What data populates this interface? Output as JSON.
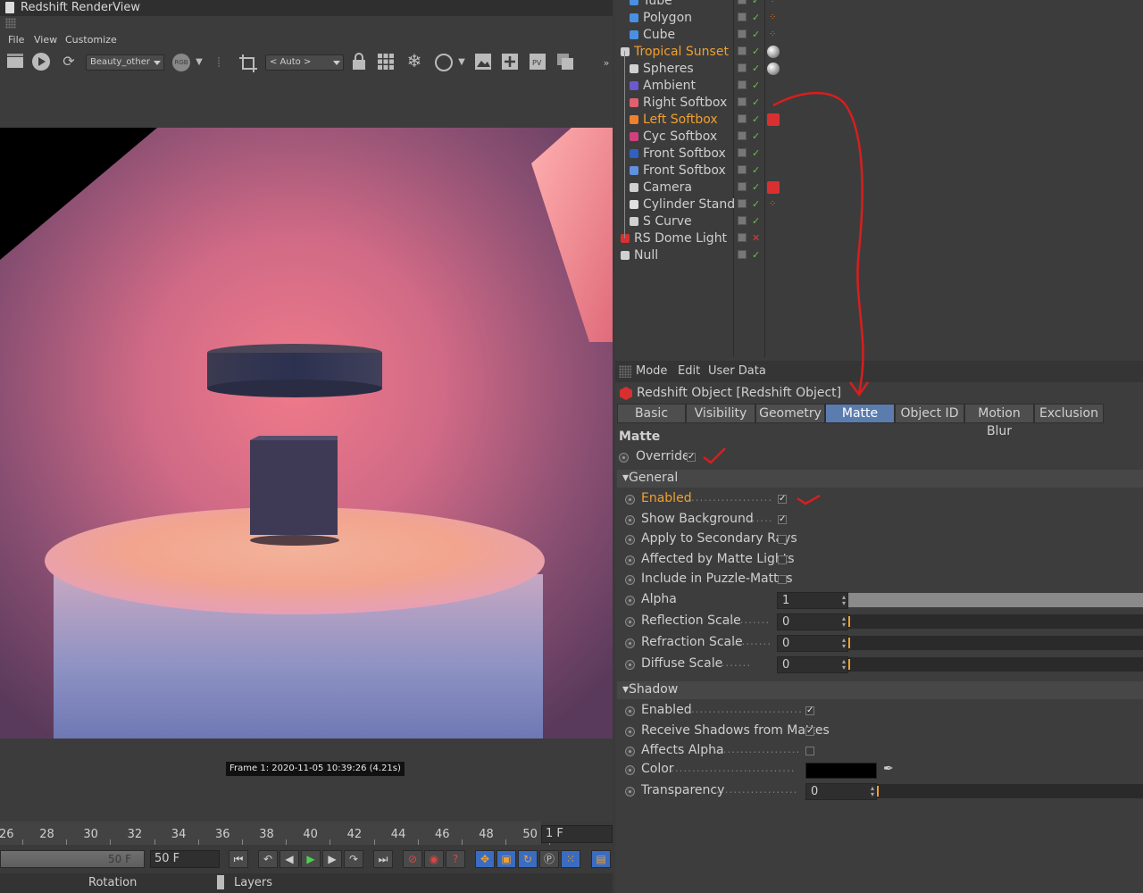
{
  "render_view": {
    "title": "Redshift RenderView",
    "menu": [
      "File",
      "View",
      "Customize"
    ],
    "aov_dropdown": "Beauty_other",
    "rgb_label": "RGB",
    "zoom_dropdown": "< Auto >",
    "frame_info": "Frame  1:  2020-11-05  10:39:26  (4.21s)"
  },
  "timeline": {
    "ticks": [
      "26",
      "28",
      "30",
      "32",
      "34",
      "36",
      "38",
      "40",
      "42",
      "44",
      "46",
      "48",
      "50"
    ],
    "current_frame": "1 F",
    "slider_value": "50 F",
    "end_frame": "50 F",
    "bottom_tabs": [
      "Rotation",
      "Layers"
    ]
  },
  "object_manager": {
    "objects": [
      {
        "name": "Tube",
        "color": "#4a90e2"
      },
      {
        "name": "Polygon",
        "color": "#4a90e2"
      },
      {
        "name": "Cube",
        "color": "#4a90e2"
      },
      {
        "name": "Tropical Sunset",
        "color": "#d0d0d0"
      },
      {
        "name": "Spheres",
        "color": "#d0d0d0"
      },
      {
        "name": "Ambient",
        "color": "#6a5acd"
      },
      {
        "name": "Right Softbox",
        "color": "#e06070"
      },
      {
        "name": "Left Softbox",
        "color": "#f08030"
      },
      {
        "name": "Cyc Softbox",
        "color": "#d04080"
      },
      {
        "name": "Front Softbox",
        "color": "#3060c0"
      },
      {
        "name": "Front Softbox",
        "color": "#6090e0"
      },
      {
        "name": "Camera",
        "color": "#d0d0d0"
      },
      {
        "name": "Cylinder Stand",
        "color": "#e0e0e0"
      },
      {
        "name": "S Curve",
        "color": "#d0d0d0"
      },
      {
        "name": "RS Dome Light",
        "color": "#d83030"
      },
      {
        "name": "Null",
        "color": "#d0d0d0"
      }
    ]
  },
  "attributes": {
    "menu": [
      "Mode",
      "Edit",
      "User Data"
    ],
    "header": "Redshift Object [Redshift Object]",
    "tabs": [
      "Basic",
      "Visibility",
      "Geometry",
      "Matte",
      "Object ID",
      "Motion Blur",
      "Exclusion"
    ],
    "active_tab": "Matte",
    "section": "Matte",
    "override_label": "Override",
    "general_group": "General",
    "general": [
      {
        "label": "Enabled",
        "checked": true
      },
      {
        "label": "Show Background",
        "checked": true
      },
      {
        "label": "Apply to Secondary Rays",
        "checked": false
      },
      {
        "label": "Affected by Matte Lights",
        "checked": false
      },
      {
        "label": "Include in Puzzle-Mattes",
        "checked": false
      }
    ],
    "numeric": [
      {
        "label": "Alpha",
        "value": "1",
        "fraction": 1.0
      },
      {
        "label": "Reflection Scale",
        "value": "0",
        "fraction": 0.0
      },
      {
        "label": "Refraction Scale",
        "value": "0",
        "fraction": 0.0
      },
      {
        "label": "Diffuse Scale",
        "value": "0",
        "fraction": 0.0
      }
    ],
    "shadow_group": "Shadow",
    "shadow": [
      {
        "label": "Enabled",
        "checked": true
      },
      {
        "label": "Receive Shadows from Mattes",
        "checked": true
      },
      {
        "label": "Affects Alpha",
        "checked": false
      }
    ],
    "color_label": "Color",
    "color_value": "#000000",
    "transparency_label": "Transparency",
    "transparency_value": "0"
  }
}
